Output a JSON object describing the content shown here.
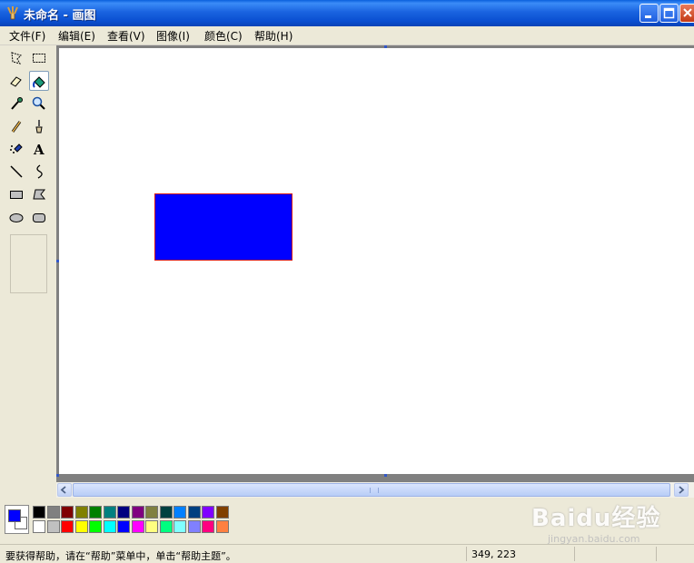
{
  "window": {
    "title": "未命名 - 画图",
    "min_label": "_",
    "max_label": "□",
    "close_label": "×"
  },
  "menu": {
    "items": [
      {
        "label": "文件(F)"
      },
      {
        "label": "编辑(E)"
      },
      {
        "label": "查看(V)"
      },
      {
        "label": "图像(I)"
      },
      {
        "label": "颜色(C)"
      },
      {
        "label": "帮助(H)"
      }
    ]
  },
  "toolbox": {
    "tools": [
      {
        "icon": "free-select-icon"
      },
      {
        "icon": "rect-select-icon"
      },
      {
        "icon": "eraser-icon"
      },
      {
        "icon": "fill-bucket-icon",
        "selected": true
      },
      {
        "icon": "color-picker-icon"
      },
      {
        "icon": "magnifier-icon"
      },
      {
        "icon": "pencil-icon"
      },
      {
        "icon": "brush-icon"
      },
      {
        "icon": "airbrush-icon"
      },
      {
        "icon": "text-icon",
        "glyph": "A"
      },
      {
        "icon": "line-icon"
      },
      {
        "icon": "curve-icon"
      },
      {
        "icon": "rectangle-icon"
      },
      {
        "icon": "polygon-icon"
      },
      {
        "icon": "ellipse-icon"
      },
      {
        "icon": "rounded-rect-icon"
      }
    ]
  },
  "canvas": {
    "shape_fill": "#0000ff",
    "shape_border": "#d41818"
  },
  "palette": {
    "foreground": "#0000ff",
    "background": "#ffffff",
    "top_row": [
      "#000000",
      "#808080",
      "#800000",
      "#808000",
      "#008000",
      "#008080",
      "#000080",
      "#800080",
      "#808040",
      "#004040",
      "#0080ff",
      "#004080",
      "#8000ff",
      "#804000"
    ],
    "bottom_row": [
      "#ffffff",
      "#c0c0c0",
      "#ff0000",
      "#ffff00",
      "#00ff00",
      "#00ffff",
      "#0000ff",
      "#ff00ff",
      "#ffff80",
      "#00ff80",
      "#80ffff",
      "#8080ff",
      "#ff0080",
      "#ff8040"
    ]
  },
  "status": {
    "help_text": "要获得帮助，请在“帮助”菜单中，单击“帮助主题”。",
    "coords": "349, 223"
  },
  "watermark": {
    "main": "Baidu经验",
    "sub": "jingyan.baidu.com"
  }
}
